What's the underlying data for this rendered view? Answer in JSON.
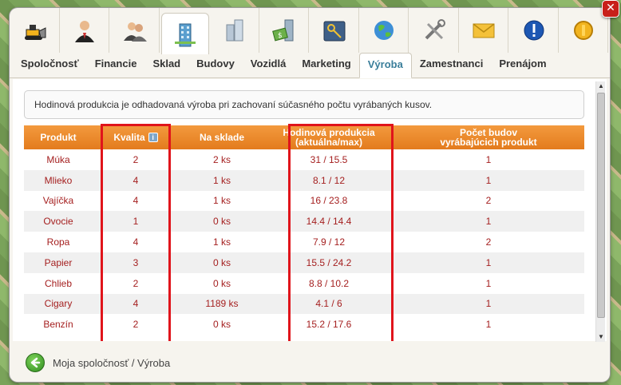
{
  "icons": [
    {
      "name": "bulldozer-icon",
      "active": false
    },
    {
      "name": "businessman-icon",
      "active": false
    },
    {
      "name": "employees-icon",
      "active": false
    },
    {
      "name": "office-building-icon",
      "active": true
    },
    {
      "name": "buildings-icon",
      "active": false
    },
    {
      "name": "money-building-icon",
      "active": false
    },
    {
      "name": "keys-icon",
      "active": false
    },
    {
      "name": "globe-icon",
      "active": false
    },
    {
      "name": "tools-icon",
      "active": false
    },
    {
      "name": "envelope-icon",
      "active": false
    },
    {
      "name": "help-icon",
      "active": false
    },
    {
      "name": "coin-icon",
      "active": false
    }
  ],
  "tabs": [
    {
      "label": "Spoločnosť",
      "active": false
    },
    {
      "label": "Financie",
      "active": false
    },
    {
      "label": "Sklad",
      "active": false
    },
    {
      "label": "Budovy",
      "active": false
    },
    {
      "label": "Vozidlá",
      "active": false
    },
    {
      "label": "Marketing",
      "active": false
    },
    {
      "label": "Výroba",
      "active": true
    },
    {
      "label": "Zamestnanci",
      "active": false
    },
    {
      "label": "Prenájom",
      "active": false
    }
  ],
  "info_text": "Hodinová produkcia je odhadovaná výroba pri zachovaní súčasného počtu vyrábaných kusov.",
  "table": {
    "headers": {
      "product": "Produkt",
      "quality": "Kvalita",
      "stock": "Na sklade",
      "hourly_line1": "Hodinová produkcia",
      "hourly_line2": "(aktuálna/max)",
      "buildings_line1": "Počet budov",
      "buildings_line2": "vyrábajúcich produkt"
    },
    "rows": [
      {
        "product": "Múka",
        "quality": "2",
        "stock": "2 ks",
        "hourly": "31 / 15.5",
        "buildings": "1"
      },
      {
        "product": "Mlieko",
        "quality": "4",
        "stock": "1 ks",
        "hourly": "8.1 / 12",
        "buildings": "1"
      },
      {
        "product": "Vajíčka",
        "quality": "4",
        "stock": "1 ks",
        "hourly": "16 / 23.8",
        "buildings": "2"
      },
      {
        "product": "Ovocie",
        "quality": "1",
        "stock": "0 ks",
        "hourly": "14.4 / 14.4",
        "buildings": "1"
      },
      {
        "product": "Ropa",
        "quality": "4",
        "stock": "1 ks",
        "hourly": "7.9 / 12",
        "buildings": "2"
      },
      {
        "product": "Papier",
        "quality": "3",
        "stock": "0 ks",
        "hourly": "15.5 / 24.2",
        "buildings": "1"
      },
      {
        "product": "Chlieb",
        "quality": "2",
        "stock": "0 ks",
        "hourly": "8.8 / 10.2",
        "buildings": "1"
      },
      {
        "product": "Cigary",
        "quality": "4",
        "stock": "1189 ks",
        "hourly": "4.1 / 6",
        "buildings": "1"
      },
      {
        "product": "Benzín",
        "quality": "2",
        "stock": "0 ks",
        "hourly": "15.2 / 17.6",
        "buildings": "1"
      }
    ]
  },
  "breadcrumb": "Moja spoločnosť / Výroba",
  "colors": {
    "header_orange": "#e9852a",
    "value_red": "#a52020",
    "active_tab": "#3a7e9a",
    "highlight_red": "#e0141b"
  }
}
